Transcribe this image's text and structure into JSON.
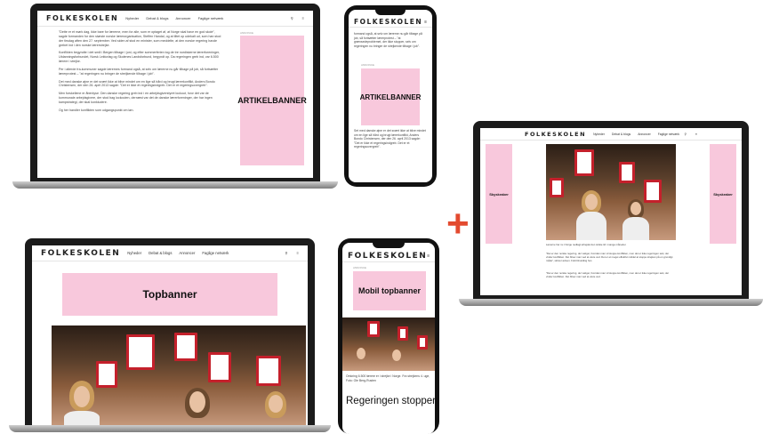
{
  "site": {
    "logo": "FOLKESKOLEN",
    "nav": [
      "Nyheder",
      "Debat & blogs",
      "Annoncer",
      "Faglige netværk"
    ],
    "nav_icons": [
      "search-icon",
      "menu-icon"
    ]
  },
  "colors": {
    "ad_pink": "#f8c8dc",
    "accent_plus": "#e34a2f",
    "sign_red": "#c4202b"
  },
  "ad_labels": {
    "annonce": "ANNONCE",
    "artikelbanner": "ARTIKELBANNER",
    "topbanner": "Topbanner",
    "mobil_topbanner": "Mobil topbanner",
    "skyskraber": "Skyskraber"
  },
  "article": {
    "paragraphs": [
      "\"Dette er et mørk dag, ikke bare for lærerne, men for alle, som er optaget af, at Norge skal have en god skole\", sagde formanden for den største norske lærerorganisation, Steffen Handal, og at tiltet op udekalt ud, som han stod der tirsdag aften den 27. september. Ved siden af stod en minister, som meddelte, at den norske regering havde grebet ind i den norske lærerstrejke.",
      "Konflikten begyndte i det små i Bergen tilbage i juni, og efter sommerferien tog de tre nordiskerne lærerforeninger, Utdanningsforbundet, Norsk Lektorlag og Skolenes Landsforbund, begyndt op. Da regeringen greb ind, var 6.500 lærere i strejke.",
      "Per i alterde fra-kommuner sagde lærernes formand også, at selv om lærerne nu går tilbage på job, så fortsætter lærerprotest – \"at regeringen nu bringer de streijkende tilbage i job\".",
      "Det med danske øjne er det svært ikke at blive mindet om en lige så hård og brugt lærerkonflikt, Anders Bondo Christensen, der den 26. april 2013 sagde: \"Det er ikke et regeringsindgreb. Det er et regeringsovergreb\".",
      "Men forskellene er åbenlyse. Den danske regering greb ind i en arbejdsgiverstyret lockout, hvor det var de kommunale arbejdsgivere, der stod bag lockouten, dernæst var det de danske lærerforeninger, der har ingen kampstrategi, der skal konkludere.",
      "Og her handler konflikten som udgangspunkt om løn."
    ],
    "phone_text_top": "formand også, at selv om lærerne nu går tilbage på job, så fortsætter lærerprotest – \"at grænsedeproblemet, der ikke stopper, selv om regeringen nu bringer de strejkende tilbage i job\".",
    "phone_text_bottom": "Set med danske øjne er det svært ikke at blive mindet om en lige så hård og brugt lærerkonflikt, Anders Bondo Christensen, der den 26. april 2013 sagde: \"Det er ikke et regeringsindgreb. Det er et regeringsovergreb\".",
    "caption_right": "Lærerne har nu i Norge nedlagt arbejdet den sidste tid i mange måneder.",
    "right_para1": "\"Det er den norske regering, der vælger, hvordan man vil stoppe konflikten, men det er ikke regeringen selv, der vinder konflikten. Det bliver man ved at være ved. Det er et meget effektivt middel at stoppe strejken på en grundigt måde\", skriver avisen. Fuld tilmelding hos",
    "right_para2": "\"Det er den norske regering, der vælger, hvordan man vil stoppe konflikten, men det er ikke regeringen selv, der vinder konflikten. Det bliver man ved at være ved.",
    "mobile_caption": "Omkring 6.500 lærere er i strejke i Norge. Fra strejkens 4. uge, Foto: Ole Berg-Rusten",
    "mobile_headline": "Regeringen stopper"
  }
}
